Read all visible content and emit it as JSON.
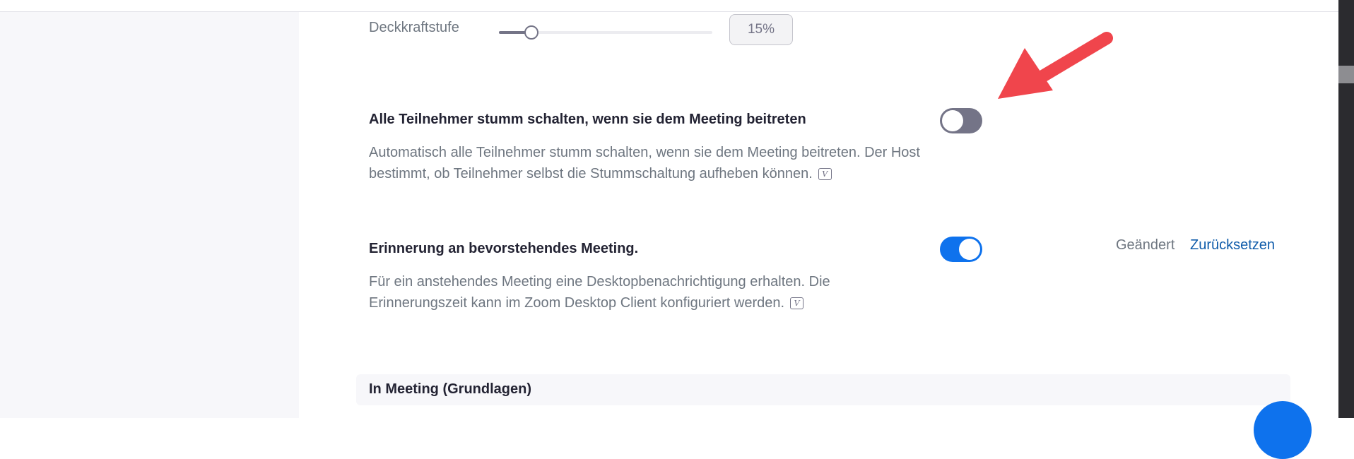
{
  "opacity": {
    "label": "Deckkraftstufe",
    "value": 0.15,
    "display": "15%"
  },
  "settings": [
    {
      "title": "Alle Teilnehmer stumm schalten, wenn sie dem Meeting beitreten",
      "description": "Automatisch alle Teilnehmer stumm schalten, wenn sie dem Meeting beitreten. Der Host bestimmt, ob Teilnehmer selbst die Stummschaltung aufheben können.",
      "enabled": false
    },
    {
      "title": "Erinnerung an bevorstehendes Meeting.",
      "description": "Für ein anstehendes Meeting eine Desktopbenachrichtigung erhalten. Die Erinnerungszeit kann im Zoom Desktop Client konfiguriert werden.",
      "enabled": true,
      "changed_label": "Geändert",
      "reset_label": "Zurücksetzen"
    }
  ],
  "section": {
    "title": "In Meeting (Grundlagen)"
  },
  "icons": {
    "info": "video-info-icon",
    "annotation": "red-arrow-annotation"
  },
  "colors": {
    "accent": "#0e72ed",
    "toggle_off": "#747487",
    "link": "#0e5baa",
    "annotation": "#f0454c"
  }
}
